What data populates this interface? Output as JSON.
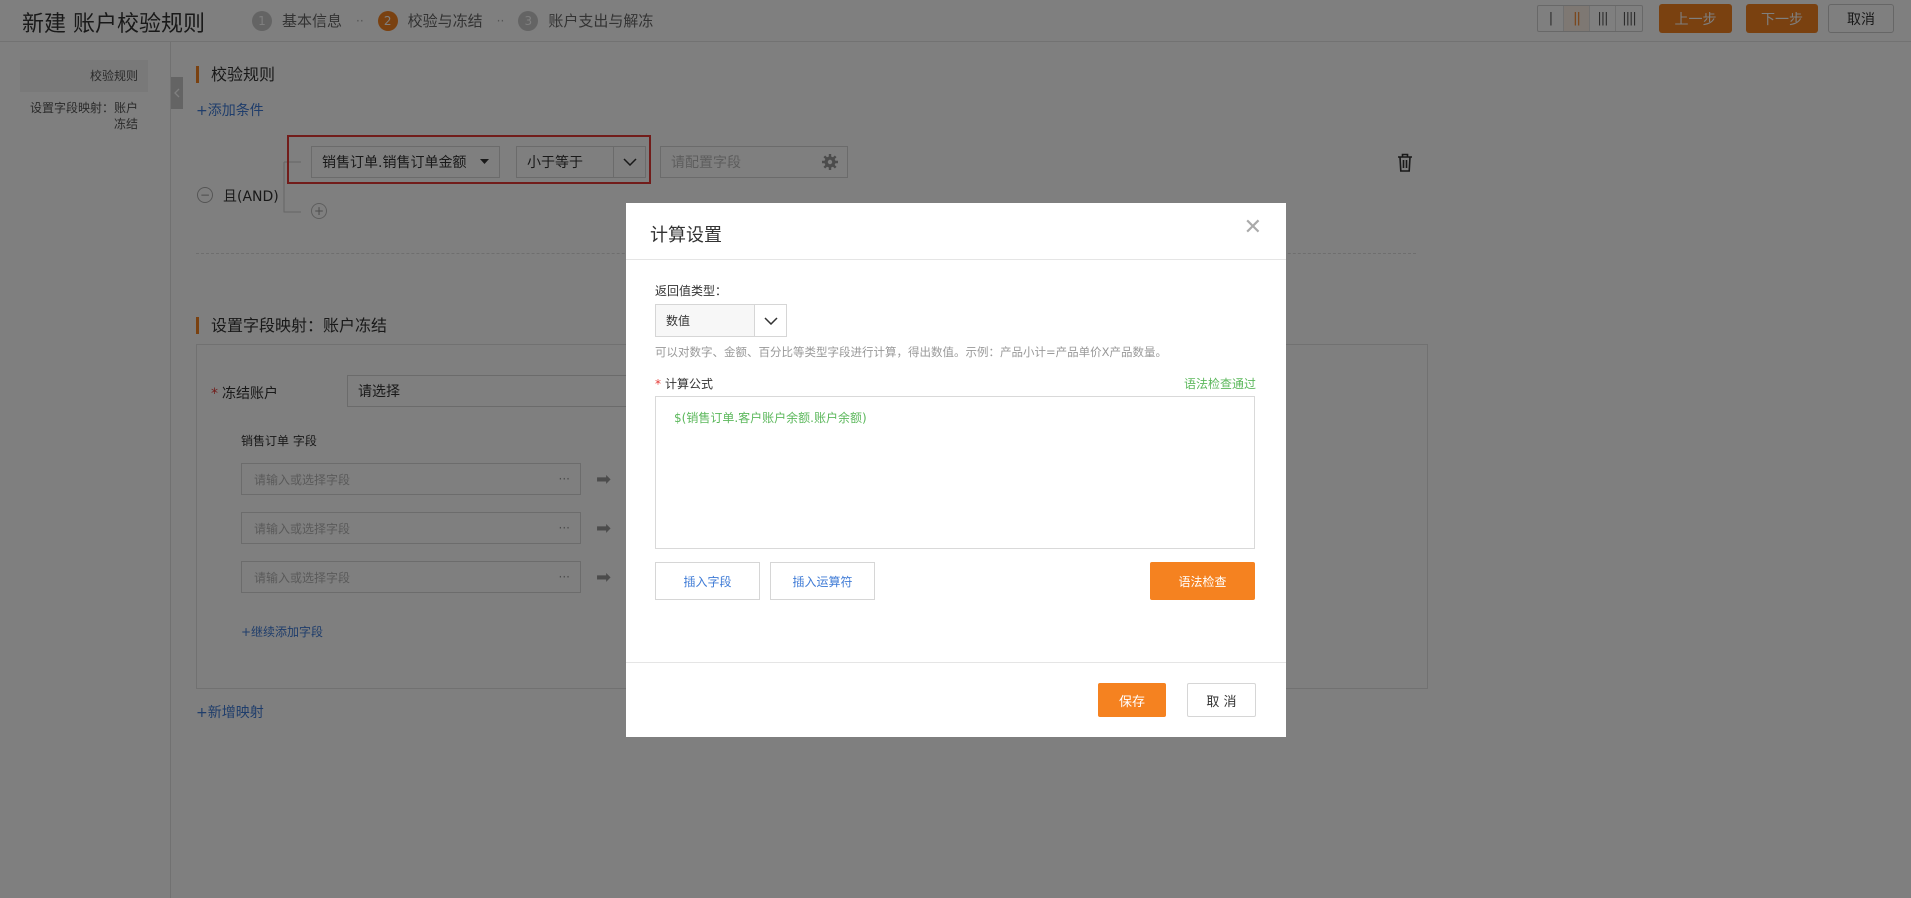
{
  "header": {
    "title": "新建 账户校验规则",
    "steps": [
      {
        "num": "1",
        "label": "基本信息"
      },
      {
        "num": "2",
        "label": "校验与冻结"
      },
      {
        "num": "3",
        "label": "账户支出与解冻"
      }
    ],
    "step_separator": "··",
    "layout_options": [
      "|",
      "||",
      "|||",
      "||||"
    ],
    "prev_label": "上一步",
    "next_label": "下一步",
    "cancel_label": "取消"
  },
  "sidebar": {
    "items": [
      {
        "label": "校验规则"
      },
      {
        "label": "设置字段映射：账户冻结"
      }
    ]
  },
  "rules": {
    "title": "校验规则",
    "add_condition": "+添加条件",
    "logic_label": "且(AND)",
    "logic_minus": "−",
    "add_symbol": "+",
    "field_value": "销售订单.销售订单金额",
    "operator_value": "小于等于",
    "value_placeholder": "请配置字段"
  },
  "mapping": {
    "title": "设置字段映射：账户冻结",
    "freeze_account_label": "冻结账户",
    "required_mark": "*",
    "freeze_account_value": "请选择",
    "source_header": "销售订单 字段",
    "field_placeholder": "请输入或选择字段",
    "field_dots": "···",
    "add_field": "+继续添加字段",
    "add_mapping": "+新增映射"
  },
  "modal": {
    "title": "计算设置",
    "close_symbol": "✕",
    "return_type_label": "返回值类型：",
    "return_type_value": "数值",
    "hint": "可以对数字、金额、百分比等类型字段进行计算，得出数值。示例：产品小计=产品单价X产品数量。",
    "formula_required_mark": "*",
    "formula_label": "计算公式",
    "syntax_status": "语法检查通过",
    "formula_value": "$(销售订单.客户账户余额.账户余额)",
    "insert_field": "插入字段",
    "insert_operator": "插入运算符",
    "syntax_check": "语法检查",
    "save": "保存",
    "cancel": "取 消"
  },
  "colors": {
    "accent": "#f58220",
    "link": "#3f7bd6",
    "success": "#5cb85c",
    "highlight_frame": "#e53935"
  }
}
